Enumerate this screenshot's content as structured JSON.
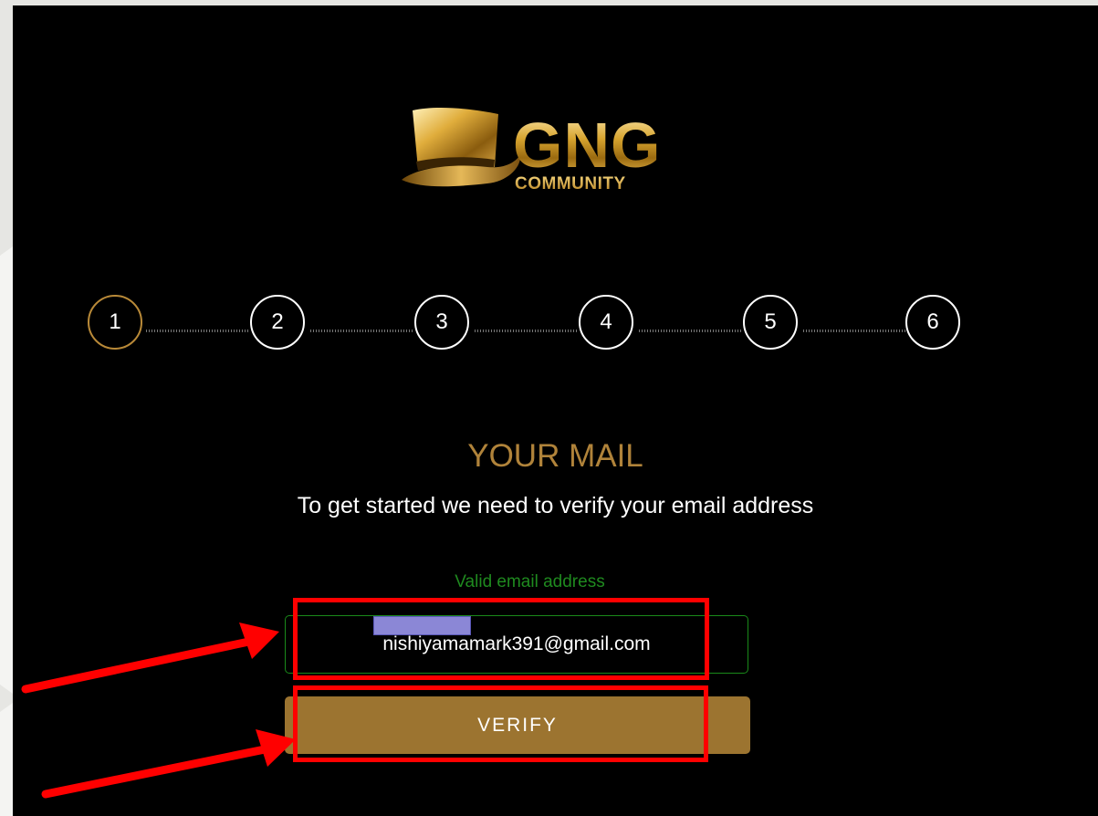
{
  "brand": {
    "name": "GNG",
    "subtitle": "COMMUNITY"
  },
  "stepper": {
    "steps": [
      "1",
      "2",
      "3",
      "4",
      "5",
      "6"
    ],
    "active_step": "1"
  },
  "page": {
    "title": "YOUR MAIL",
    "subtitle": "To get started we need to verify your email address"
  },
  "email": {
    "validation_message": "Valid email address",
    "value": "nishiyamamark391@gmail.com"
  },
  "verify_button": {
    "label": "VERIFY"
  },
  "colors": {
    "accent_gold": "#b0833a",
    "button_gold": "#9c7430",
    "valid_green": "#1f8a1f",
    "annotation_red": "#ff0000",
    "background": "#000000"
  },
  "icons": {
    "logo": "top-hat-icon"
  }
}
